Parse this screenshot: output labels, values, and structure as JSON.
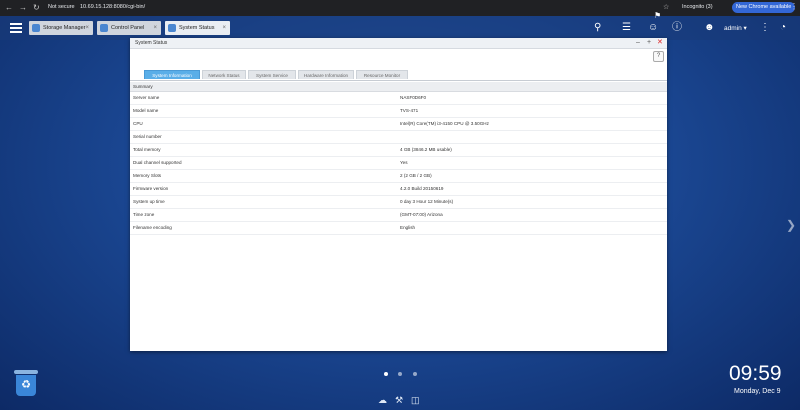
{
  "browser": {
    "secure_label": "Not secure",
    "url": "10.69.15.128:8080/cgi-bin/",
    "incognito_label": "Incognito (3)",
    "new_chrome_label": "New Chrome available"
  },
  "taskbar": {
    "tabs": [
      {
        "label": "Storage Manager",
        "active": false
      },
      {
        "label": "Control Panel",
        "active": false
      },
      {
        "label": "System Status",
        "active": true
      }
    ],
    "user": "admin ▾"
  },
  "window": {
    "title": "System Status",
    "help_label": "?",
    "tabs": [
      {
        "label": "System Information",
        "active": true
      },
      {
        "label": "Network Status",
        "active": false
      },
      {
        "label": "System Service",
        "active": false
      },
      {
        "label": "Hardware Information",
        "active": false
      },
      {
        "label": "Resource Monitor",
        "active": false
      }
    ],
    "summary_label": "Summary",
    "rows": [
      {
        "key": "Server name",
        "value": "NASF0D6F0"
      },
      {
        "key": "Model name",
        "value": "TVS-471"
      },
      {
        "key": "CPU",
        "value": "Intel(R) Core(TM) i3-4150 CPU @ 3.50GHz"
      },
      {
        "key": "Serial number",
        "value": ""
      },
      {
        "key": "Total memory",
        "value": "4 GB (3846.2 MB usable)"
      },
      {
        "key": "Dual channel supported",
        "value": "Yes"
      },
      {
        "key": "Memory Slots",
        "value": "2 (2 GB / 2 GB)"
      },
      {
        "key": "Firmware version",
        "value": "4.2.0 Build 20150619"
      },
      {
        "key": "System up time",
        "value": "0 day 3 Hour 12 Minute(s)"
      },
      {
        "key": "Time zone",
        "value": "(GMT-07:00) Arizona"
      },
      {
        "key": "Filename encoding",
        "value": "English"
      }
    ]
  },
  "desktop": {
    "time": "09:59",
    "date": "Monday, Dec 9"
  },
  "colors": {
    "accent": "#5aaee8",
    "desktop_bg": "#1b4894",
    "chrome_bar": "#202124",
    "new_chrome_button": "#3367d6"
  },
  "icons": [
    "back-icon",
    "forward-icon",
    "reload-icon",
    "star-icon",
    "incognito-icon",
    "menu-icon",
    "search-icon",
    "tasks-icon",
    "user-account-icon",
    "notification-icon",
    "info-icon",
    "person-icon",
    "more-vert-icon",
    "speedometer-icon",
    "recycle-bin-icon",
    "cloud-icon",
    "tools-icon",
    "book-icon",
    "chevron-right-icon"
  ]
}
